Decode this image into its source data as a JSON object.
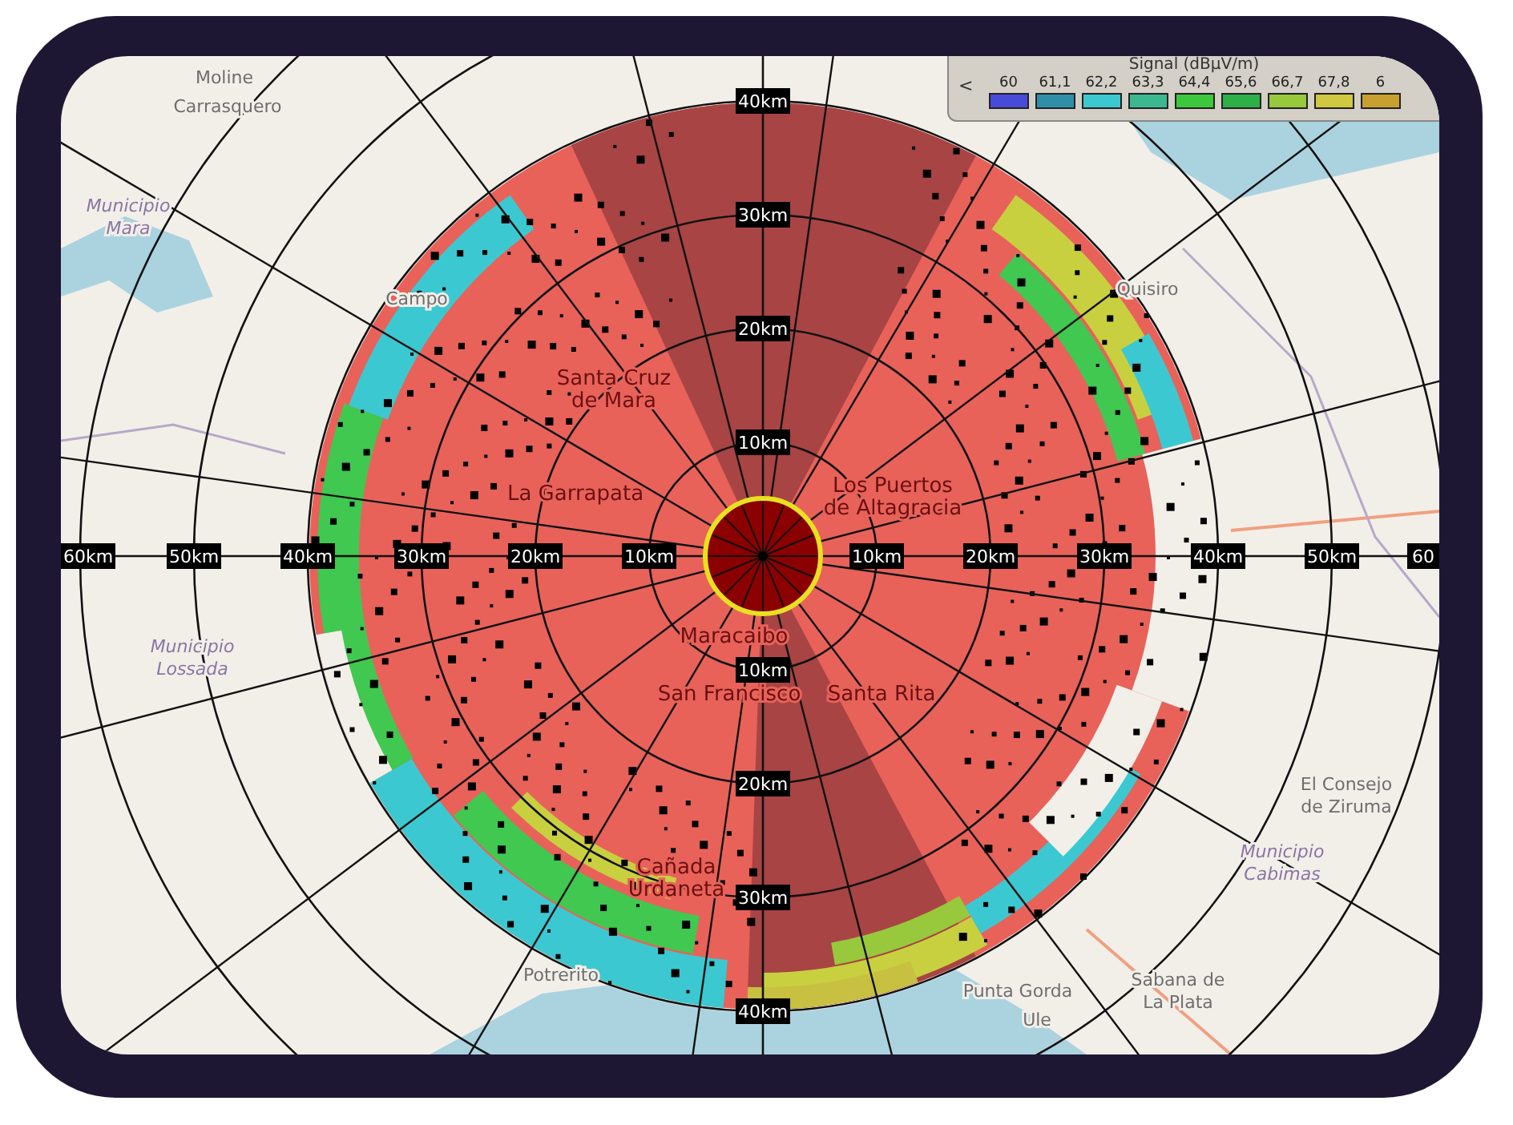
{
  "legend": {
    "title": "Signal (dBμV/m)",
    "back_button": "<",
    "items": [
      {
        "label": "60",
        "color": "#4a4ad8"
      },
      {
        "label": "61,1",
        "color": "#2f8fa8"
      },
      {
        "label": "62,2",
        "color": "#3cc8d0"
      },
      {
        "label": "63,3",
        "color": "#3cb890"
      },
      {
        "label": "64,4",
        "color": "#3cc83c"
      },
      {
        "label": "65,6",
        "color": "#2eb048"
      },
      {
        "label": "66,7",
        "color": "#98c83c"
      },
      {
        "label": "67,8",
        "color": "#d0c840"
      },
      {
        "label": "6",
        "color": "#c8a030"
      }
    ]
  },
  "range_labels": {
    "west": [
      "60km",
      "50km",
      "40km",
      "30km",
      "20km",
      "10km"
    ],
    "east": [
      "10km",
      "20km",
      "30km",
      "40km",
      "50km",
      "60"
    ],
    "north": [
      "40km",
      "30km",
      "20km",
      "10km"
    ],
    "south": [
      "10km",
      "20km",
      "30km",
      "40km"
    ]
  },
  "places": [
    {
      "kind": "town",
      "lines": [
        "Moline"
      ]
    },
    {
      "kind": "town",
      "lines": [
        "Carrasquero"
      ]
    },
    {
      "kind": "municipality",
      "lines": [
        "Municipio",
        "Mara"
      ]
    },
    {
      "kind": "town",
      "lines": [
        "Campo"
      ]
    },
    {
      "kind": "municipality",
      "lines": [
        "Municipio",
        "Lossada"
      ]
    },
    {
      "kind": "town",
      "lines": [
        "Quisiro"
      ]
    },
    {
      "kind": "town",
      "lines": [
        "El Consejo",
        "de Ziruma"
      ]
    },
    {
      "kind": "municipality",
      "lines": [
        "Municipio",
        "Cabimas"
      ]
    },
    {
      "kind": "town",
      "lines": [
        "Potrerito"
      ]
    },
    {
      "kind": "town",
      "lines": [
        "Punta Gorda"
      ]
    },
    {
      "kind": "town",
      "lines": [
        "Ule"
      ]
    },
    {
      "kind": "town",
      "lines": [
        "Sabana de",
        "La Plata"
      ]
    },
    {
      "kind": "covered",
      "lines": [
        "Santa Cruz",
        "de Mara"
      ]
    },
    {
      "kind": "covered",
      "lines": [
        "La Garrapata"
      ]
    },
    {
      "kind": "covered",
      "lines": [
        "Maracaibo"
      ]
    },
    {
      "kind": "covered",
      "lines": [
        "Los Puertos",
        "de Altagracia"
      ]
    },
    {
      "kind": "covered",
      "lines": [
        "San Francisco"
      ]
    },
    {
      "kind": "covered",
      "lines": [
        "Santa Rita"
      ]
    },
    {
      "kind": "covered",
      "lines": [
        "Cañada",
        "Urdaneta"
      ]
    }
  ]
}
